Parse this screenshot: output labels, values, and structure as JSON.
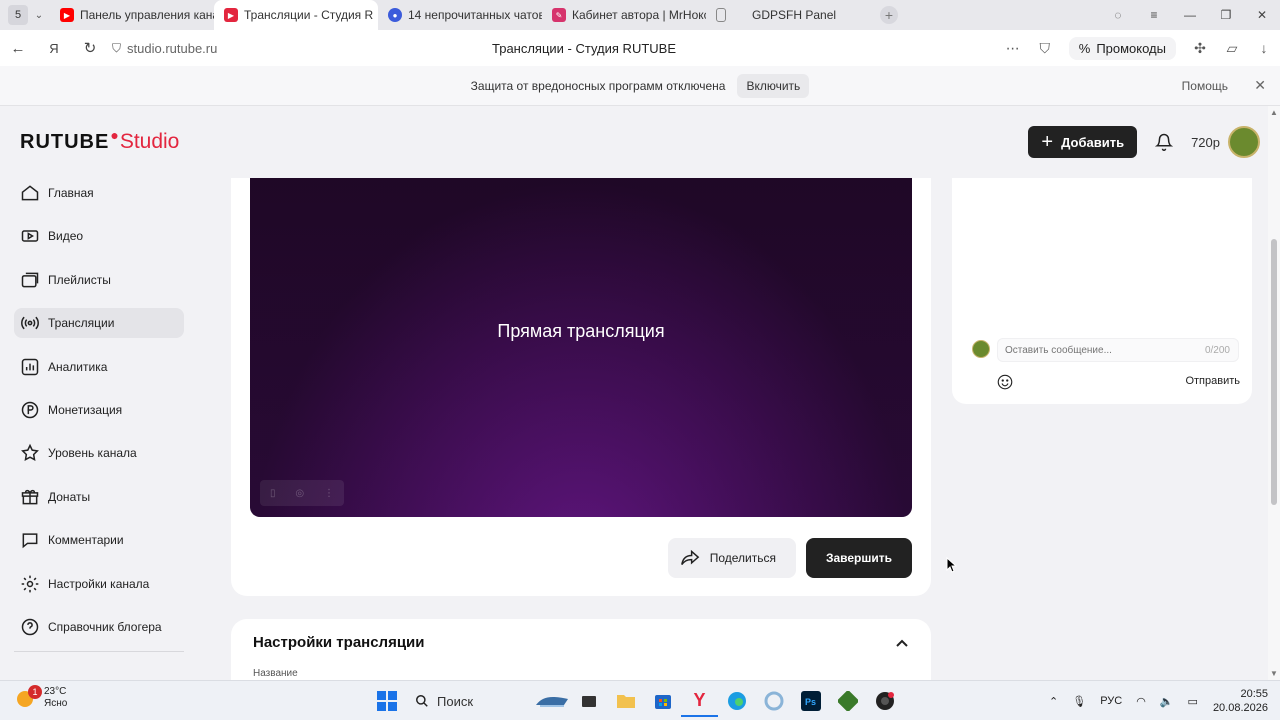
{
  "browser": {
    "tab_count": "5",
    "tabs": [
      {
        "label": "Панель управления кана",
        "favicon_color": "#ff0000",
        "active": false
      },
      {
        "label": "Трансляции - Студия R",
        "favicon_color": "#e3263f",
        "active": true
      },
      {
        "label": "14 непрочитанных чатов",
        "favicon_color": "#3b5bdb",
        "active": false
      },
      {
        "label": "Кабинет автора | MrHокс",
        "favicon_color": "#d6336c",
        "active": false
      },
      {
        "label": "GDPSFH Panel",
        "favicon_color": "#888888",
        "active": false
      }
    ],
    "url": "studio.rutube.ru",
    "page_title": "Трансляции - Студия RUTUBE",
    "promo_label": "Промокоды"
  },
  "infobar": {
    "message": "Защита от вредоносных программ отключена",
    "enable_label": "Включить",
    "help_label": "Помощь"
  },
  "studio": {
    "logo_main": "RUTUBE",
    "logo_studio": "Studio",
    "add_label": "Добавить",
    "quality_label": "720p",
    "accent_color": "#e3263f"
  },
  "sidebar": {
    "items": [
      {
        "label": "Главная",
        "icon": "home-icon"
      },
      {
        "label": "Видео",
        "icon": "video-icon"
      },
      {
        "label": "Плейлисты",
        "icon": "playlist-icon"
      },
      {
        "label": "Трансляции",
        "icon": "broadcast-icon",
        "active": true
      },
      {
        "label": "Аналитика",
        "icon": "analytics-icon"
      },
      {
        "label": "Монетизация",
        "icon": "money-icon"
      },
      {
        "label": "Уровень канала",
        "icon": "star-icon"
      },
      {
        "label": "Донаты",
        "icon": "donate-icon"
      },
      {
        "label": "Комментарии",
        "icon": "comment-icon"
      },
      {
        "label": "Настройки канала",
        "icon": "gear-icon"
      },
      {
        "label": "Справочник блогера",
        "icon": "help-icon"
      }
    ]
  },
  "player": {
    "title": "Прямая трансляция"
  },
  "actions": {
    "share_label": "Поделиться",
    "finish_label": "Завершить"
  },
  "settings": {
    "title": "Настройки трансляции",
    "name_label": "Название"
  },
  "chat": {
    "placeholder": "Оставить сообщение...",
    "counter": "0/200",
    "send_label": "Отправить"
  },
  "taskbar": {
    "notification_count": "1",
    "temperature": "23°C",
    "weather": "Ясно",
    "search_label": "Поиск",
    "language": "РУС",
    "time": "20:55",
    "date": "20.08.2026"
  }
}
